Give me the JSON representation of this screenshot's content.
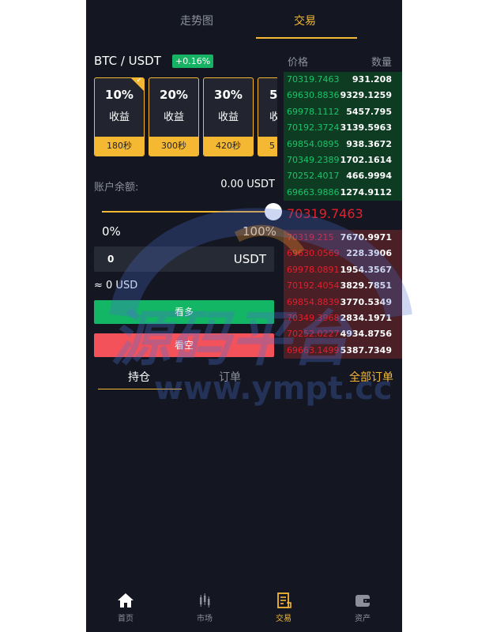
{
  "top_tabs": [
    "走势图",
    "交易"
  ],
  "pair": {
    "name": "BTC / USDT",
    "change": "+0.16%"
  },
  "cards": [
    {
      "pct": "10%",
      "label": "收益",
      "time": "180秒",
      "selected": true
    },
    {
      "pct": "20%",
      "label": "收益",
      "time": "300秒",
      "selected": false
    },
    {
      "pct": "30%",
      "label": "收益",
      "time": "420秒",
      "selected": false
    },
    {
      "pct": "5",
      "label": "收",
      "time": "5",
      "selected": false
    }
  ],
  "balance": {
    "label": "账户余额:",
    "value": "0.00 USDT"
  },
  "slider": {
    "min": "0%",
    "max": "100%",
    "value_percent": 100
  },
  "amount": {
    "value": "0",
    "unit": "USDT"
  },
  "approx": "≈ 0 USD",
  "buttons": {
    "long": "看多",
    "short": "看空"
  },
  "sub_tabs": {
    "hold": "持仓",
    "order": "订单",
    "all": "全部订单"
  },
  "orderbook": {
    "price_header": "价格",
    "qty_header": "数量",
    "bids": [
      {
        "price": "70319.7463",
        "qty": "931.208"
      },
      {
        "price": "69630.8836",
        "qty": "9329.1259"
      },
      {
        "price": "69978.1112",
        "qty": "5457.795"
      },
      {
        "price": "70192.3724",
        "qty": "3139.5963"
      },
      {
        "price": "69854.0895",
        "qty": "938.3672"
      },
      {
        "price": "70349.2389",
        "qty": "1702.1614"
      },
      {
        "price": "70252.4017",
        "qty": "466.9994"
      },
      {
        "price": "69663.9886",
        "qty": "1274.9112"
      }
    ],
    "mid": "70319.7463",
    "asks": [
      {
        "price": "70319.215",
        "qty": "7670.9971"
      },
      {
        "price": "69630.0569",
        "qty": "228.3906"
      },
      {
        "price": "69978.0891",
        "qty": "1954.3567"
      },
      {
        "price": "70192.4054",
        "qty": "3829.7851"
      },
      {
        "price": "69854.8839",
        "qty": "3770.5349"
      },
      {
        "price": "70349.3968",
        "qty": "2834.1971"
      },
      {
        "price": "70252.0227",
        "qty": "4934.8756"
      },
      {
        "price": "69663.1499",
        "qty": "5387.7349"
      }
    ]
  },
  "watermark": {
    "text": "源码平台",
    "url": "www.ympt.cc"
  },
  "nav": [
    {
      "label": "首页",
      "icon": "home-icon"
    },
    {
      "label": "市场",
      "icon": "market-icon"
    },
    {
      "label": "交易",
      "icon": "trade-icon",
      "active": true
    },
    {
      "label": "资产",
      "icon": "wallet-icon"
    }
  ],
  "colors": {
    "accent": "#f5b833",
    "up": "#12b664",
    "down": "#f4525a",
    "bg": "#141722"
  }
}
